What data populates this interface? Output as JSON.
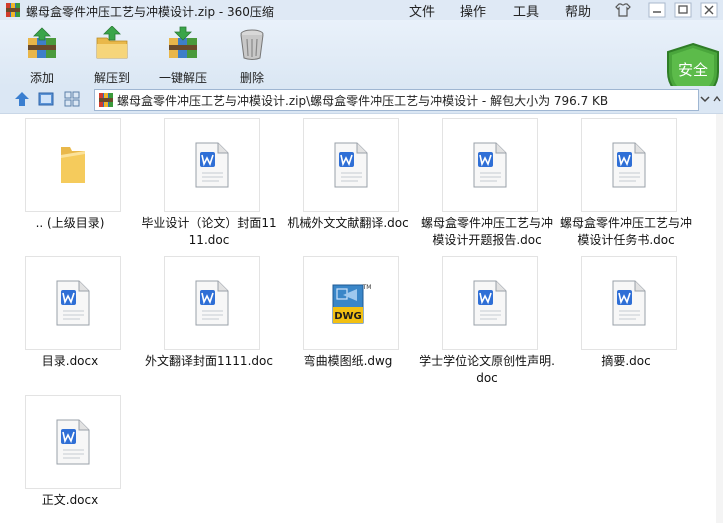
{
  "window": {
    "title": "螺母盒零件冲压工艺与冲模设计.zip - 360压缩",
    "menus": [
      "文件",
      "操作",
      "工具",
      "帮助"
    ]
  },
  "toolbar": {
    "buttons": [
      {
        "label": "添加",
        "icon": "add-archive-icon"
      },
      {
        "label": "解压到",
        "icon": "extract-to-folder-icon"
      },
      {
        "label": "一键解压",
        "icon": "one-click-extract-icon"
      },
      {
        "label": "删除",
        "icon": "trash-bin-icon"
      }
    ],
    "badge_label": "安全"
  },
  "address": {
    "path": "螺母盒零件冲压工艺与冲模设计.zip\\螺母盒零件冲压工艺与冲模设计 - 解包大小为 796.7 KB"
  },
  "files": [
    {
      "name": ".. (上级目录)",
      "type": "folder"
    },
    {
      "name": "毕业设计（论文）封面1111.doc",
      "type": "doc"
    },
    {
      "name": "机械外文文献翻译.doc",
      "type": "doc"
    },
    {
      "name": "螺母盒零件冲压工艺与冲模设计开题报告.doc",
      "type": "doc"
    },
    {
      "name": "螺母盒零件冲压工艺与冲模设计任务书.doc",
      "type": "doc"
    },
    {
      "name": "目录.docx",
      "type": "doc"
    },
    {
      "name": "外文翻译封面1111.doc",
      "type": "doc"
    },
    {
      "name": "弯曲模图纸.dwg",
      "type": "dwg"
    },
    {
      "name": "学士学位论文原创性声明.doc",
      "type": "doc"
    },
    {
      "name": "摘要.doc",
      "type": "doc"
    },
    {
      "name": "正文.docx",
      "type": "doc"
    }
  ],
  "colors": {
    "wps_blue": "#2f6fd6",
    "folder_yellow": "#f5cb5c",
    "shield_green": "#4aa63c",
    "dwg_yellow": "#f2c012"
  }
}
